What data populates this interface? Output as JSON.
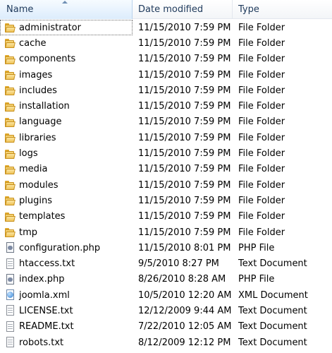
{
  "columns": {
    "name": "Name",
    "date_modified": "Date modified",
    "type": "Type"
  },
  "files": [
    {
      "name": "administrator",
      "date": "11/15/2010 7:59 PM",
      "type": "File Folder",
      "icon": "folder-icon"
    },
    {
      "name": "cache",
      "date": "11/15/2010 7:59 PM",
      "type": "File Folder",
      "icon": "folder-icon"
    },
    {
      "name": "components",
      "date": "11/15/2010 7:59 PM",
      "type": "File Folder",
      "icon": "folder-icon"
    },
    {
      "name": "images",
      "date": "11/15/2010 7:59 PM",
      "type": "File Folder",
      "icon": "folder-icon"
    },
    {
      "name": "includes",
      "date": "11/15/2010 7:59 PM",
      "type": "File Folder",
      "icon": "folder-icon"
    },
    {
      "name": "installation",
      "date": "11/15/2010 7:59 PM",
      "type": "File Folder",
      "icon": "folder-icon"
    },
    {
      "name": "language",
      "date": "11/15/2010 7:59 PM",
      "type": "File Folder",
      "icon": "folder-icon"
    },
    {
      "name": "libraries",
      "date": "11/15/2010 7:59 PM",
      "type": "File Folder",
      "icon": "folder-icon"
    },
    {
      "name": "logs",
      "date": "11/15/2010 7:59 PM",
      "type": "File Folder",
      "icon": "folder-icon"
    },
    {
      "name": "media",
      "date": "11/15/2010 7:59 PM",
      "type": "File Folder",
      "icon": "folder-icon"
    },
    {
      "name": "modules",
      "date": "11/15/2010 7:59 PM",
      "type": "File Folder",
      "icon": "folder-icon"
    },
    {
      "name": "plugins",
      "date": "11/15/2010 7:59 PM",
      "type": "File Folder",
      "icon": "folder-icon"
    },
    {
      "name": "templates",
      "date": "11/15/2010 7:59 PM",
      "type": "File Folder",
      "icon": "folder-icon"
    },
    {
      "name": "tmp",
      "date": "11/15/2010 7:59 PM",
      "type": "File Folder",
      "icon": "folder-icon"
    },
    {
      "name": "configuration.php",
      "date": "11/15/2010 8:01 PM",
      "type": "PHP File",
      "icon": "php-file-icon"
    },
    {
      "name": "htaccess.txt",
      "date": "9/5/2010 8:27 PM",
      "type": "Text Document",
      "icon": "text-file-icon"
    },
    {
      "name": "index.php",
      "date": "8/26/2010 8:28 AM",
      "type": "PHP File",
      "icon": "php-file-icon"
    },
    {
      "name": "joomla.xml",
      "date": "10/5/2010 12:20 AM",
      "type": "XML Document",
      "icon": "xml-file-icon"
    },
    {
      "name": "LICENSE.txt",
      "date": "12/12/2009 9:44 AM",
      "type": "Text Document",
      "icon": "text-file-icon"
    },
    {
      "name": "README.txt",
      "date": "7/22/2010 12:05 AM",
      "type": "Text Document",
      "icon": "text-file-icon"
    },
    {
      "name": "robots.txt",
      "date": "8/12/2009 12:12 PM",
      "type": "Text Document",
      "icon": "text-file-icon"
    }
  ],
  "colors": {
    "header_text": "#1e395b",
    "folder": "#e4b13a"
  }
}
